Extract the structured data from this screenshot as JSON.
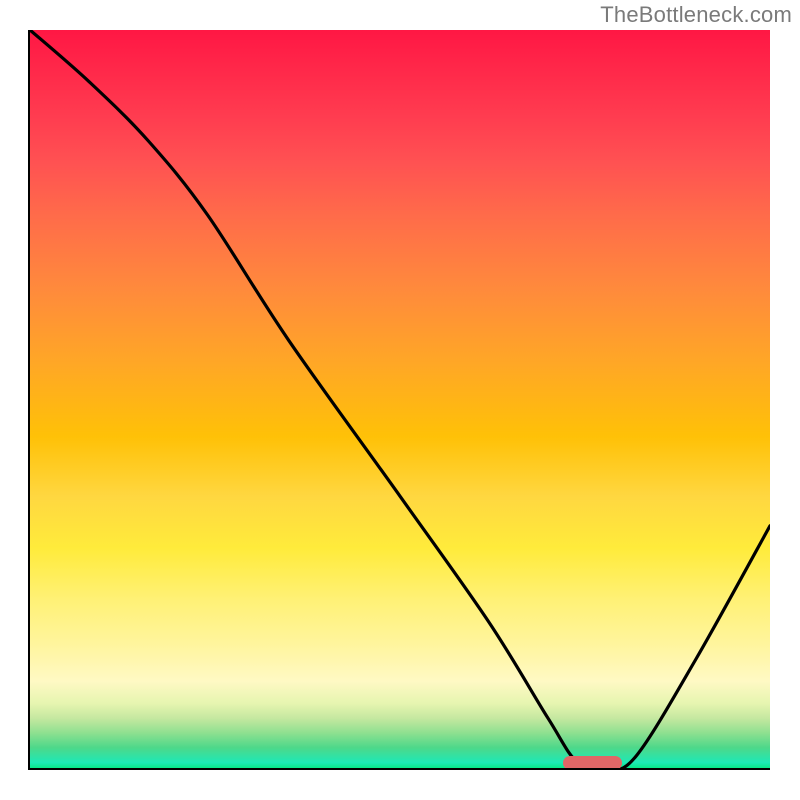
{
  "watermark": "TheBottleneck.com",
  "chart_data": {
    "type": "line",
    "title": "",
    "xlabel": "",
    "ylabel": "",
    "xlim": [
      0,
      100
    ],
    "ylim": [
      0,
      100
    ],
    "grid": false,
    "series": [
      {
        "name": "bottleneck-curve",
        "x": [
          0,
          8,
          16,
          24,
          35,
          50,
          62,
          70,
          74,
          78,
          82,
          90,
          100
        ],
        "values": [
          100,
          93,
          85,
          75,
          58,
          37,
          20,
          7,
          1,
          0,
          2,
          15,
          33
        ]
      }
    ],
    "marker": {
      "x_start": 72,
      "x_end": 80,
      "color": "#e06666"
    },
    "gradient_stops": [
      {
        "pct": 0,
        "color": "#ff1744"
      },
      {
        "pct": 50,
        "color": "#ffc107"
      },
      {
        "pct": 80,
        "color": "#fff176"
      },
      {
        "pct": 100,
        "color": "#00e676"
      }
    ]
  }
}
